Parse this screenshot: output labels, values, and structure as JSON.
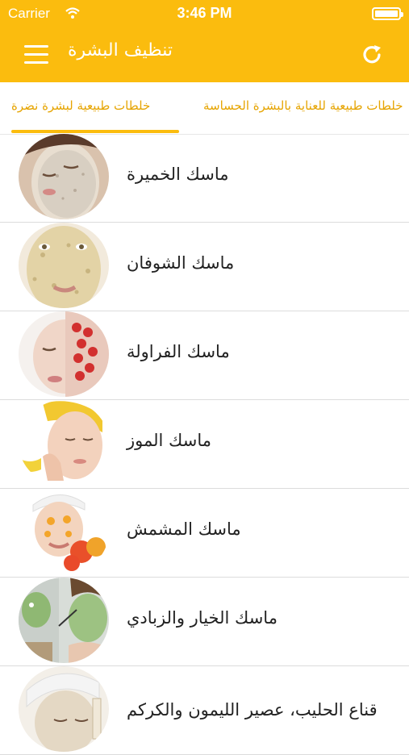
{
  "status_bar": {
    "carrier": "Carrier",
    "time": "3:46 PM"
  },
  "nav": {
    "title": "تنظيف البشرة"
  },
  "tabs": [
    {
      "label": "خلطات طبيعية لبشرة نضرة",
      "active": true
    },
    {
      "label": "خلطات طبيعية للعناية بالبشرة الحساسة",
      "active": false
    }
  ],
  "items": [
    {
      "label": "ماسك الخميرة"
    },
    {
      "label": "ماسك الشوفان"
    },
    {
      "label": "ماسك الفراولة"
    },
    {
      "label": "ماسك الموز"
    },
    {
      "label": "ماسك المشمش"
    },
    {
      "label": "ماسك الخيار والزبادي"
    },
    {
      "label": "قناع الحليب، عصير الليمون والكركم"
    }
  ],
  "colors": {
    "accent": "#fbbc0e",
    "tab_text": "#e6a400",
    "divider": "#dcdcdc"
  }
}
